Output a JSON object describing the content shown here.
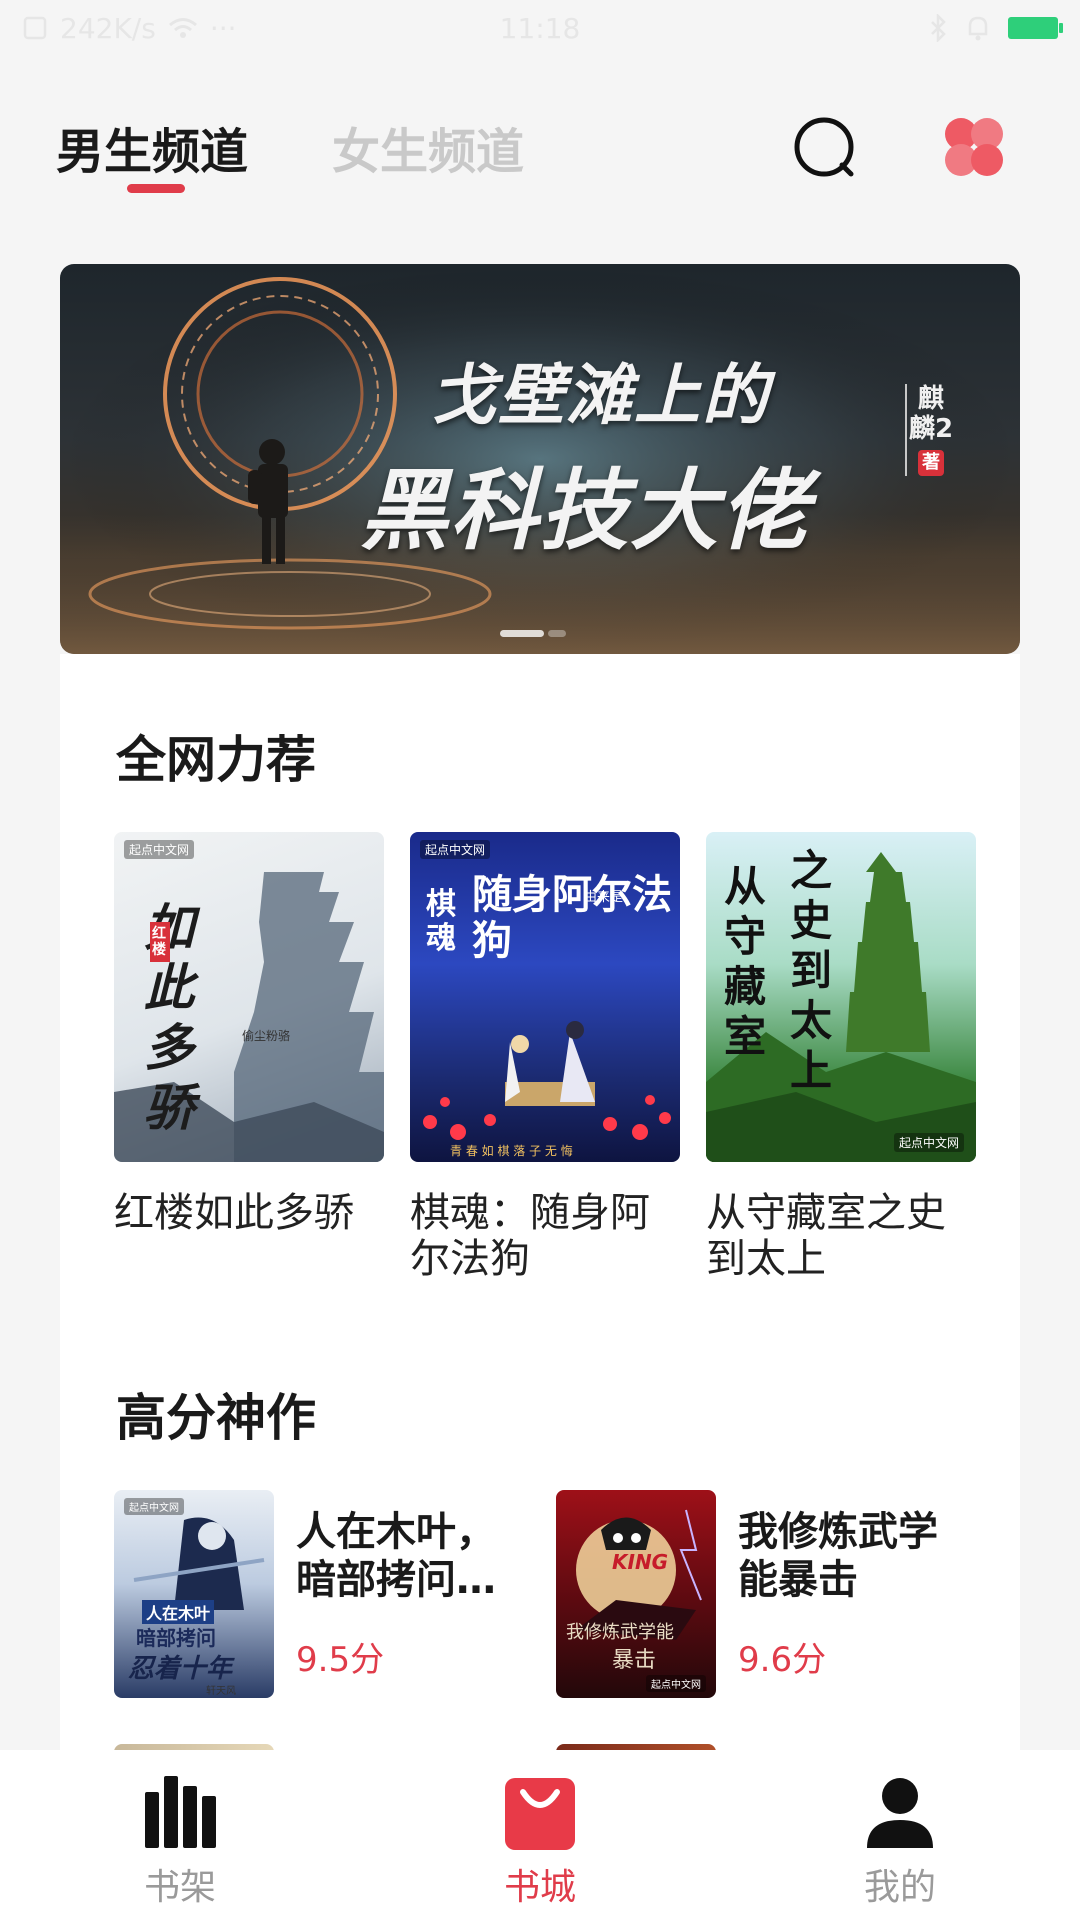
{
  "status_bar": {
    "net_speed": "242K/s",
    "dots": "···",
    "time": "11:18"
  },
  "header": {
    "tab_male": "男生频道",
    "tab_female": "女生频道",
    "accent_color": "#e03c4a"
  },
  "banner": {
    "title_line1": "戈壁滩上的",
    "title_line2": "黑科技大佬",
    "author": "麒麟2",
    "seal": "著",
    "slide_count": 2,
    "active_slide": 1
  },
  "recommend": {
    "title": "全网力荐",
    "books": [
      {
        "name": "红楼如此多骄",
        "cover_text": "如此多骄",
        "cover_tag": "红楼",
        "cover_author": "偷尘粉骆",
        "publisher": "起点中文网"
      },
      {
        "name": "棋魂：随身阿尔法狗",
        "cover_text": "随身阿尔法狗",
        "cover_tag": "棋魂",
        "cover_author": "由来是",
        "cover_footer": "青 春 如 棋   落 子 无 悔",
        "publisher": "起点中文网"
      },
      {
        "name": "从守藏室之史到太上",
        "cover_text1": "从守藏室",
        "cover_text2": "之史到太上",
        "publisher": "起点中文网"
      }
    ]
  },
  "high_score": {
    "title": "高分神作",
    "books": [
      {
        "name": "人在木叶，暗部拷问…",
        "score": "9.5分",
        "cover_line1": "人在木叶",
        "cover_line2": "暗部拷问",
        "cover_line3": "忍着十年",
        "cover_author": "轩天风",
        "publisher": "起点中文网"
      },
      {
        "name": "我修炼武学能暴击",
        "score": "9.6分",
        "cover_line1": "KING",
        "cover_line2": "我修炼武学能",
        "cover_line3": "暴击",
        "publisher": "起点中文网"
      }
    ]
  },
  "bottom_nav": {
    "items": [
      {
        "label": "书架",
        "icon": "bookshelf-icon",
        "active": false
      },
      {
        "label": "书城",
        "icon": "bookstore-bag-icon",
        "active": true
      },
      {
        "label": "我的",
        "icon": "user-icon",
        "active": false
      }
    ]
  }
}
